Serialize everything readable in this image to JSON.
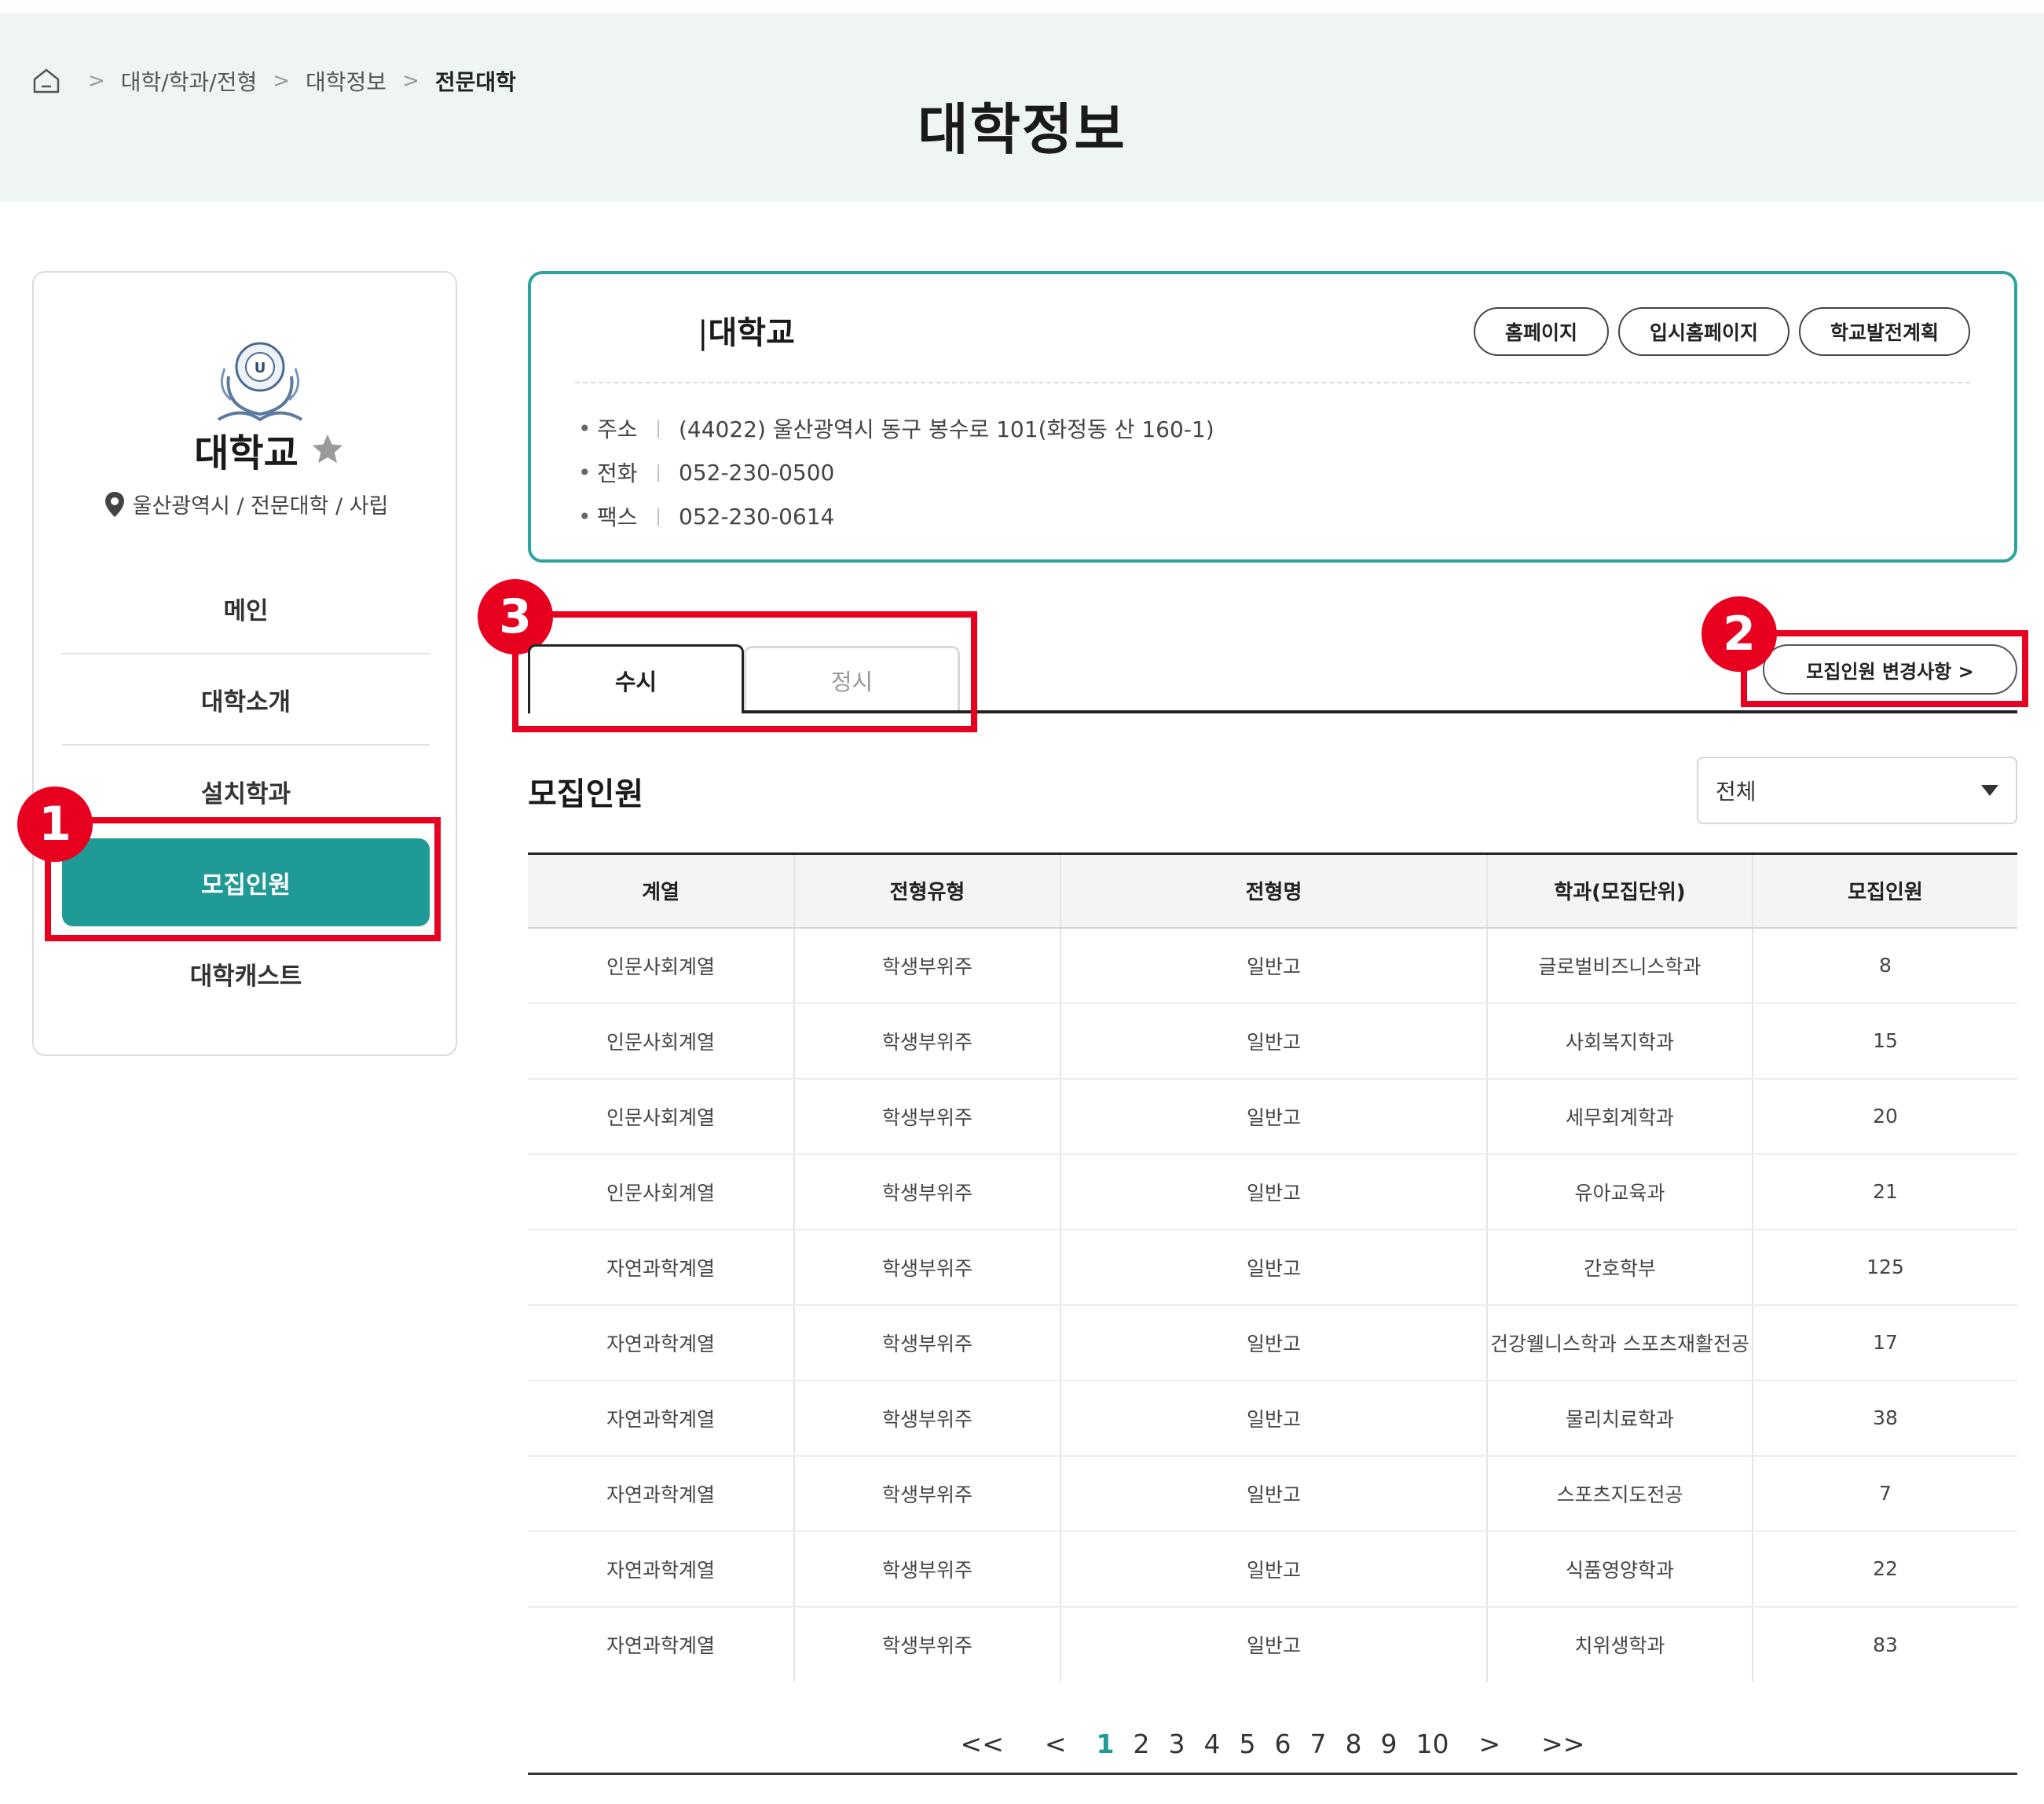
{
  "breadcrumb": {
    "items": [
      "대학/학과/전형",
      "대학정보",
      "전문대학"
    ]
  },
  "page_title": "대학정보",
  "sidebar": {
    "university_name": "대학교",
    "location": "울산광역시 / 전문대학 / 사립",
    "menu": [
      {
        "label": "메인"
      },
      {
        "label": "대학소개"
      },
      {
        "label": "설치학과"
      },
      {
        "label": "모집인원"
      },
      {
        "label": "대학캐스트"
      }
    ]
  },
  "info_card": {
    "title": "대학교",
    "title_prefix": "|",
    "buttons": [
      "홈페이지",
      "입시홈페이지",
      "학교발전계획"
    ],
    "rows": [
      {
        "key": "주소",
        "value": "(44022) 울산광역시 동구 봉수로 101(화정동 산 160-1)"
      },
      {
        "key": "전화",
        "value": "052-230-0500"
      },
      {
        "key": "팩스",
        "value": "052-230-0614"
      }
    ]
  },
  "tabs": [
    {
      "label": "수시",
      "selected": true
    },
    {
      "label": "정시",
      "selected": false
    }
  ],
  "change_button": "모집인원 변경사항 >",
  "section_title": "모집인원",
  "filter": {
    "selected": "전체"
  },
  "table": {
    "headers": [
      "계열",
      "전형유형",
      "전형명",
      "학과(모집단위)",
      "모집인원"
    ],
    "rows": [
      [
        "인문사회계열",
        "학생부위주",
        "일반고",
        "글로벌비즈니스학과",
        "8"
      ],
      [
        "인문사회계열",
        "학생부위주",
        "일반고",
        "사회복지학과",
        "15"
      ],
      [
        "인문사회계열",
        "학생부위주",
        "일반고",
        "세무회계학과",
        "20"
      ],
      [
        "인문사회계열",
        "학생부위주",
        "일반고",
        "유아교육과",
        "21"
      ],
      [
        "자연과학계열",
        "학생부위주",
        "일반고",
        "간호학부",
        "125"
      ],
      [
        "자연과학계열",
        "학생부위주",
        "일반고",
        "건강웰니스학과 스포츠재활전공",
        "17"
      ],
      [
        "자연과학계열",
        "학생부위주",
        "일반고",
        "물리치료학과",
        "38"
      ],
      [
        "자연과학계열",
        "학생부위주",
        "일반고",
        "스포츠지도전공",
        "7"
      ],
      [
        "자연과학계열",
        "학생부위주",
        "일반고",
        "식품영양학과",
        "22"
      ],
      [
        "자연과학계열",
        "학생부위주",
        "일반고",
        "치위생학과",
        "83"
      ]
    ]
  },
  "pagination": {
    "first": "<<",
    "prev": "<",
    "pages": [
      "1",
      "2",
      "3",
      "4",
      "5",
      "6",
      "7",
      "8",
      "9",
      "10"
    ],
    "current": "1",
    "next": ">",
    "last": ">>"
  },
  "annotations": {
    "badges": [
      "1",
      "2",
      "3"
    ],
    "color": "#e8001f"
  },
  "colors": {
    "accent": "#1f9a97",
    "banner_bg": "#eef5f4",
    "card_border": "#2ea3a0"
  }
}
